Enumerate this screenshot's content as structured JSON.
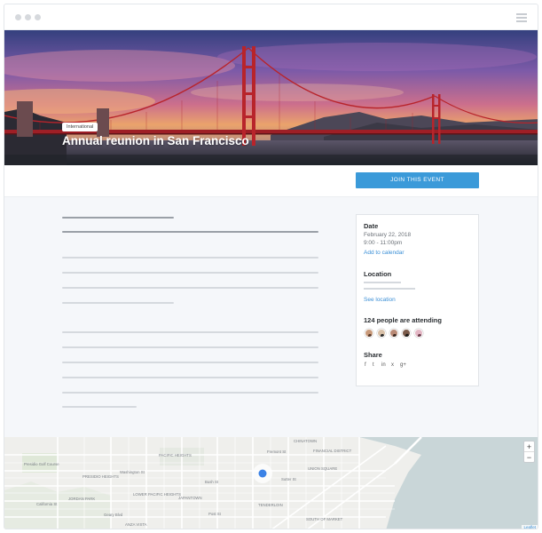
{
  "hero": {
    "badge": "International",
    "title": "Annual reunion in San Francisco"
  },
  "actions": {
    "join_label": "JOIN THIS EVENT"
  },
  "sidebar": {
    "date_heading": "Date",
    "date_value": "February 22, 2018",
    "time_value": "9:00 - 11:00pm",
    "add_calendar": "Add to calendar",
    "location_heading": "Location",
    "see_location": "See location",
    "attending_heading": "124 people are attending",
    "share_heading": "Share",
    "share_icons": [
      "f",
      "t",
      "in",
      "x",
      "g+"
    ]
  },
  "map": {
    "zoom_in": "+",
    "zoom_out": "−",
    "attribution": "Leaflet",
    "labels": {
      "l1": "Fremont St",
      "l2": "CHINATOWN",
      "l3": "FINANCIAL DISTRICT",
      "l4": "PACIFIC HEIGHTS",
      "l5": "PRESIDIO HEIGHTS",
      "l6": "UNION SQUARE",
      "l7": "LOWER PACIFIC HEIGHTS",
      "l8": "JAPANTOWN",
      "l9": "TENDERLOIN",
      "l10": "JORDAN PARK",
      "l11": "California St",
      "l12": "Geary Blvd",
      "l13": "Washington St",
      "l14": "Sutter St",
      "l15": "Presidio Golf Course",
      "l16": "ANZA VISTA",
      "l17": "SOUTH OF MARKET",
      "l18": "Bush St",
      "l19": "Post St"
    }
  },
  "colors": {
    "accent": "#3b9ad9",
    "link": "#3b8fd6",
    "bridge": "#b8242b"
  }
}
